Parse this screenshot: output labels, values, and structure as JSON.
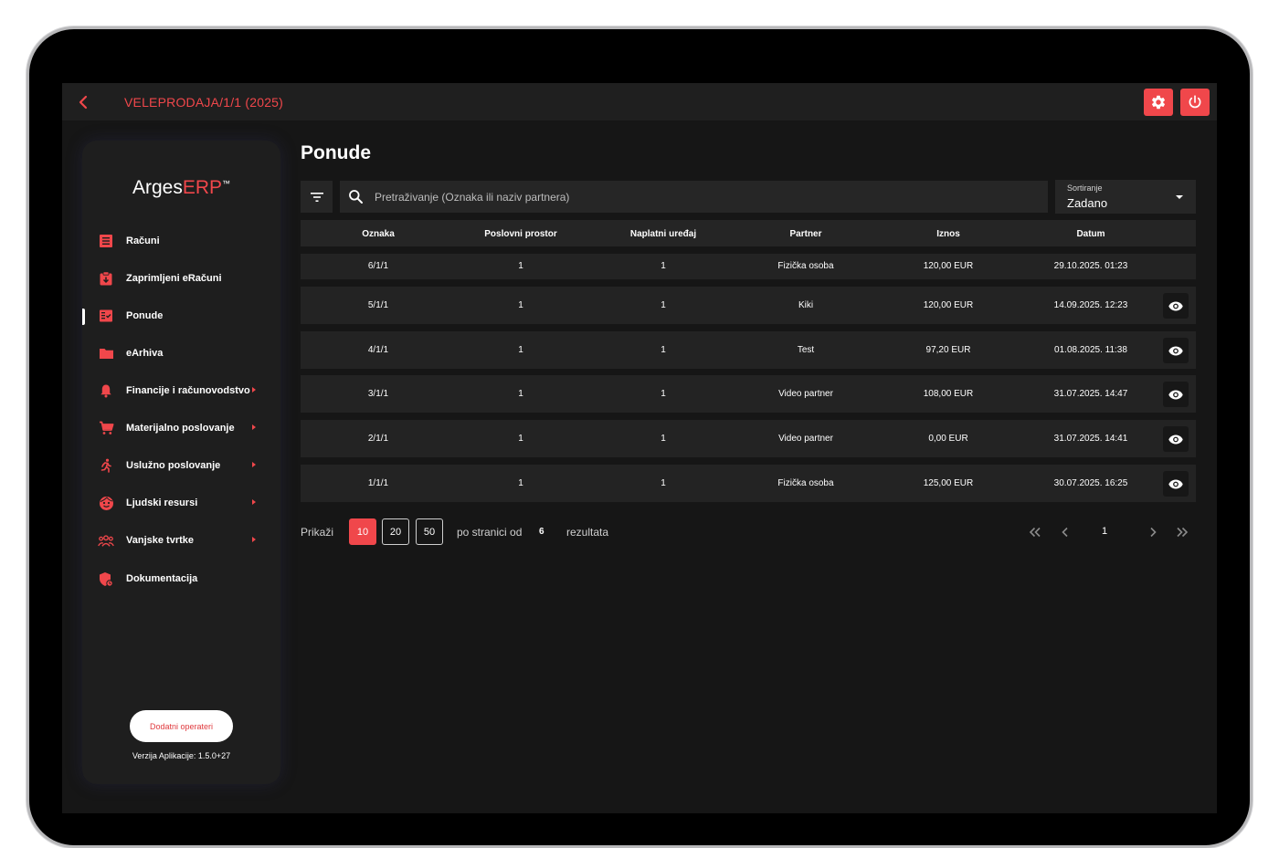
{
  "header": {
    "title": "VELEPRODAJA/1/1 (2025)"
  },
  "sidebar": {
    "logo_main": "Arges",
    "logo_accent": "ERP",
    "logo_tm": "™",
    "items": [
      {
        "label": "Računi",
        "icon": "receipt-icon"
      },
      {
        "label": "Zaprimljeni eRačuni",
        "icon": "clipboard-icon"
      },
      {
        "label": "Ponude",
        "icon": "offers-icon",
        "active": true
      },
      {
        "label": "eArhiva",
        "icon": "folder-icon"
      },
      {
        "label": "Financije i računovodstvo",
        "icon": "bell-icon",
        "submenu": true
      },
      {
        "label": "Materijalno poslovanje",
        "icon": "cart-icon",
        "submenu": true
      },
      {
        "label": "Uslužno poslovanje",
        "icon": "run-icon",
        "submenu": true
      },
      {
        "label": "Ljudski resursi",
        "icon": "face-icon",
        "submenu": true
      },
      {
        "label": "Vanjske tvrtke",
        "icon": "group-icon",
        "submenu": true
      },
      {
        "label": "Dokumentacija",
        "icon": "shield-doc-icon"
      }
    ],
    "extra_button": "Dodatni operateri",
    "version": "Verzija Aplikacije: 1.5.0+27"
  },
  "main": {
    "title": "Ponude",
    "search_placeholder": "Pretraživanje (Oznaka ili naziv partnera)",
    "sort": {
      "label": "Sortiranje",
      "value": "Zadano"
    },
    "columns": [
      "Oznaka",
      "Poslovni prostor",
      "Naplatni uređaj",
      "Partner",
      "Iznos",
      "Datum"
    ],
    "rows": [
      {
        "oznaka": "6/1/1",
        "prostor": "1",
        "uredaj": "1",
        "partner": "Fizička osoba",
        "iznos": "120,00 EUR",
        "datum": "29.10.2025. 01:23",
        "view": false
      },
      {
        "oznaka": "5/1/1",
        "prostor": "1",
        "uredaj": "1",
        "partner": "Kiki",
        "iznos": "120,00 EUR",
        "datum": "14.09.2025. 12:23",
        "view": true
      },
      {
        "oznaka": "4/1/1",
        "prostor": "1",
        "uredaj": "1",
        "partner": "Test",
        "iznos": "97,20 EUR",
        "datum": "01.08.2025. 11:38",
        "view": true
      },
      {
        "oznaka": "3/1/1",
        "prostor": "1",
        "uredaj": "1",
        "partner": "Video partner",
        "iznos": "108,00 EUR",
        "datum": "31.07.2025. 14:47",
        "view": true
      },
      {
        "oznaka": "2/1/1",
        "prostor": "1",
        "uredaj": "1",
        "partner": "Video partner",
        "iznos": "0,00 EUR",
        "datum": "31.07.2025. 14:41",
        "view": true
      },
      {
        "oznaka": "1/1/1",
        "prostor": "1",
        "uredaj": "1",
        "partner": "Fizička osoba",
        "iznos": "125,00 EUR",
        "datum": "30.07.2025. 16:25",
        "view": true
      }
    ],
    "pagination": {
      "show_label": "Prikaži",
      "page_sizes": [
        "10",
        "20",
        "50"
      ],
      "selected_size": "10",
      "per_page_label": "po stranici od",
      "total": "6",
      "results_label": "rezultata",
      "current_page": "1"
    }
  },
  "colors": {
    "accent": "#f0474b",
    "background": "#161616",
    "surface": "#232323"
  }
}
